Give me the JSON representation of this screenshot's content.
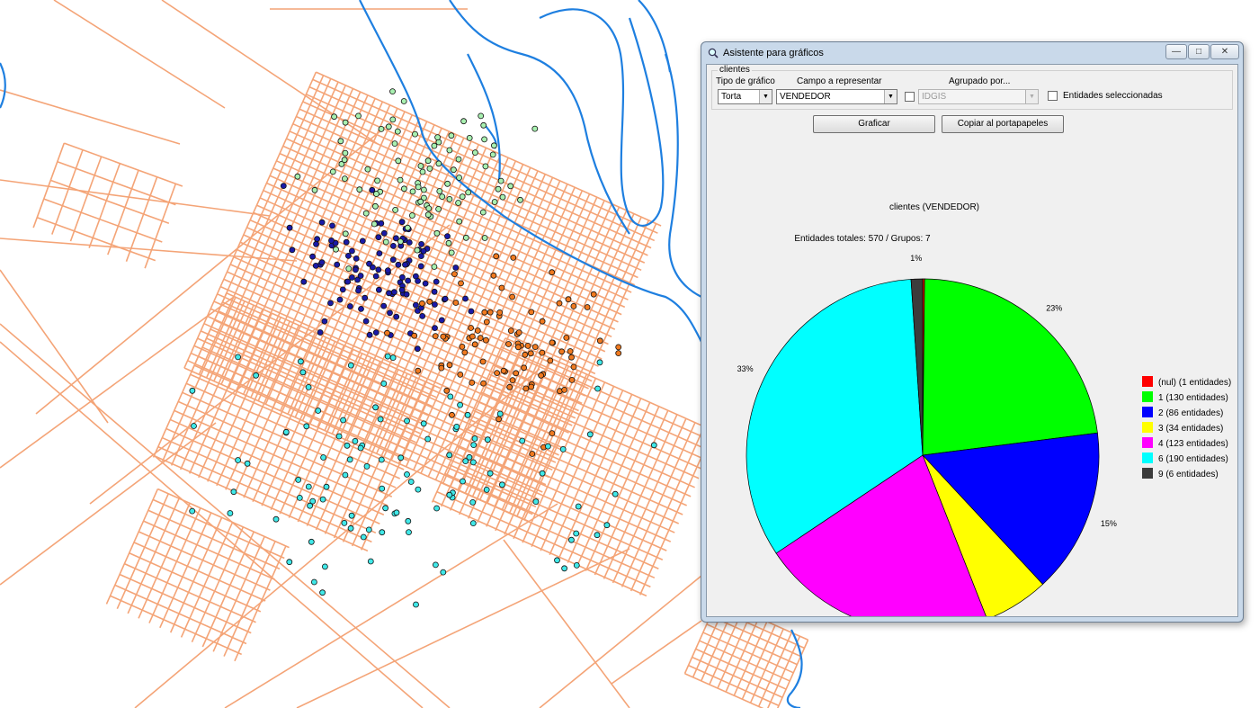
{
  "dialog": {
    "title": "Asistente para gráficos",
    "group_label": "clientes",
    "fields": {
      "chart_type_label": "Tipo de gráfico",
      "chart_type_value": "Torta",
      "field_label": "Campo a representar",
      "field_value": "VENDEDOR",
      "group_by_label": "Agrupado por...",
      "group_by_value": "IDGIS",
      "selected_label": "Entidades seleccionadas"
    },
    "buttons": {
      "graph": "Graficar",
      "copy": "Copiar al portapapeles"
    }
  },
  "chart_data": {
    "type": "pie",
    "title": "clientes (VENDEDOR)",
    "subtitle": "Entidades totales: 570 / Grupos: 7",
    "slices": [
      {
        "label": "(nul) (1 entidades)",
        "value": 1,
        "color": "#ff0000",
        "pct": ""
      },
      {
        "label": "1 (130 entidades)",
        "value": 130,
        "color": "#00ff00",
        "pct": "23%"
      },
      {
        "label": "2 (86 entidades)",
        "value": 86,
        "color": "#0000ff",
        "pct": "15%"
      },
      {
        "label": "3 (34 entidades)",
        "value": 34,
        "color": "#ffff00",
        "pct": "6%"
      },
      {
        "label": "4 (123 entidades)",
        "value": 123,
        "color": "#ff00ff",
        "pct": "22%"
      },
      {
        "label": "6 (190 entidades)",
        "value": 190,
        "color": "#00ffff",
        "pct": "33%"
      },
      {
        "label": "9 (6 entidades)",
        "value": 6,
        "color": "#3c3c3c",
        "pct": "1%"
      }
    ],
    "legend_position": "right"
  },
  "map": {
    "street_color": "#f4a477",
    "river_color": "#1e7fe0",
    "cluster_colors": [
      "#1a1aa8",
      "#a8f0b0",
      "#f07a20",
      "#40e8e8"
    ]
  }
}
